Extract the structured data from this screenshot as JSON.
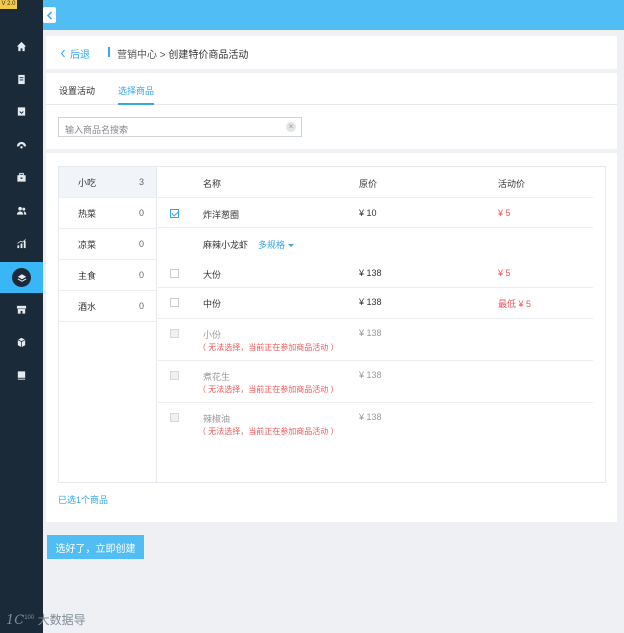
{
  "app": {
    "version": "V 2.0"
  },
  "sidebar": {
    "items": [
      {
        "icon": "home-icon"
      },
      {
        "icon": "document-icon"
      },
      {
        "icon": "bookmark-icon"
      },
      {
        "icon": "eye-icon"
      },
      {
        "icon": "briefcase-icon"
      },
      {
        "icon": "users-icon"
      },
      {
        "icon": "chart-icon"
      },
      {
        "icon": "layers-icon",
        "active": true
      },
      {
        "icon": "store-icon"
      },
      {
        "icon": "box-icon"
      },
      {
        "icon": "book-icon"
      }
    ],
    "watermark": {
      "logo": "1C",
      "sup": "100",
      "text": "大数据导"
    }
  },
  "breadcrumb": {
    "back_label": "后退",
    "parent": "营销中心",
    "separator": " > ",
    "current": "创建特价商品活动"
  },
  "tabs": [
    {
      "label": "设置活动",
      "active": false
    },
    {
      "label": "选择商品",
      "active": true
    }
  ],
  "search": {
    "placeholder": "输入商品名搜索",
    "value": ""
  },
  "categories": [
    {
      "name": "小吃",
      "count": "3",
      "active": true
    },
    {
      "name": "热菜",
      "count": "0"
    },
    {
      "name": "凉菜",
      "count": "0"
    },
    {
      "name": "主食",
      "count": "0"
    },
    {
      "name": "酒水",
      "count": "0"
    }
  ],
  "goods_table": {
    "headers": {
      "name": "名称",
      "original": "原价",
      "activity": "活动价"
    },
    "rows": [
      {
        "name": "炸洋葱圈",
        "original": "¥ 10",
        "activity": "¥ 5",
        "checked": true
      },
      {
        "name": "麻辣小龙虾",
        "spec_link": "多规格",
        "group": true
      },
      {
        "name": "大份",
        "original": "¥ 138",
        "activity": "¥ 5",
        "checked": false
      },
      {
        "name": "中份",
        "original": "¥ 138",
        "activity": "最低 ¥ 5",
        "checked": false
      },
      {
        "name": "小份",
        "original": "¥ 138",
        "note": "（ 无法选择，当前正在参加商品活动 ）",
        "disabled": true
      },
      {
        "name": "煮花生",
        "original": "¥ 138",
        "note": "（ 无法选择，当前正在参加商品活动 ）",
        "disabled": true
      },
      {
        "name": "辣椒油",
        "original": "¥ 138",
        "note": "（ 无法选择，当前正在参加商品活动 ）",
        "disabled": true
      }
    ]
  },
  "selected_count_text": "已选1个商品",
  "submit_label": "选好了，立即创建",
  "colors": {
    "accent": "#51bdf5",
    "sidebar": "#1b2a38",
    "price_red": "#f0585b",
    "link_blue": "#38a6e8"
  }
}
